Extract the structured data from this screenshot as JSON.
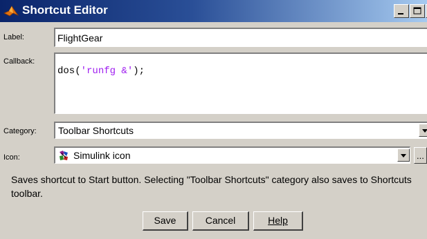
{
  "window": {
    "title": "Shortcut Editor"
  },
  "form": {
    "label_caption": "Label:",
    "label_value": "FlightGear",
    "callback_caption": "Callback:",
    "callback_prefix": "dos(",
    "callback_string": "'runfg &'",
    "callback_suffix": ");",
    "category_caption": "Category:",
    "category_value": "Toolbar Shortcuts",
    "icon_caption": "Icon:",
    "icon_value": "Simulink icon",
    "browse_label": "..."
  },
  "description": "Saves shortcut to Start button. Selecting \"Toolbar Shortcuts\" category also saves to Shortcuts toolbar.",
  "buttons": {
    "save": "Save",
    "cancel": "Cancel",
    "help": "Help"
  },
  "icons": {
    "app": "matlab-logo-icon",
    "simulink": "simulink-icon"
  }
}
